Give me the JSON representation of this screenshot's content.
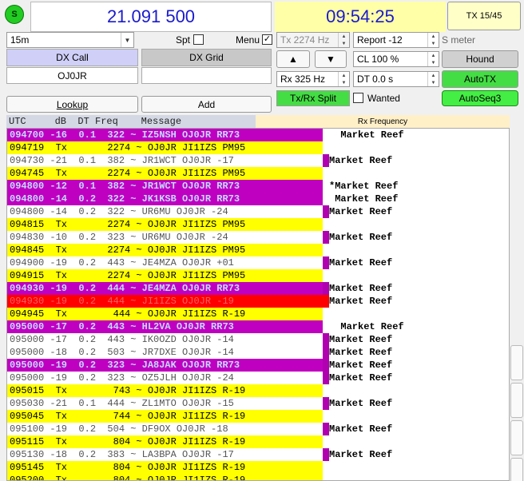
{
  "header": {
    "status_led": "S",
    "frequency": "21.091 500",
    "clock": "09:54:25",
    "tx_button": "TX 15/45"
  },
  "controls": {
    "band": "15m",
    "spt_label": "Spt",
    "menu_label": "Menu",
    "menu_checked": "✓",
    "tx_freq": "Tx  2274  Hz",
    "report": "Report -12",
    "s_meter": "S meter",
    "dx_call_label": "DX Call",
    "dx_grid_label": "DX Grid",
    "dx_call_value": "OJ0JR",
    "dx_grid_value": "",
    "up_arrow": "▲",
    "down_arrow": "▼",
    "cl": "CL  100 %",
    "hound": "Hound",
    "rx_freq": "Rx  325  Hz",
    "dt": "DT 0.0 s",
    "auto_tx": "AutoTX",
    "tx_rx_split": "Tx/Rx Split",
    "wanted_label": "Wanted",
    "auto_seq": "AutoSeq3",
    "lookup": "Lookup",
    "add": "Add"
  },
  "band_header": {
    "columns": "UTC     dB  DT Freq    Message",
    "rx_frequency": "Rx Frequency"
  },
  "decodes": [
    {
      "style": "magenta",
      "text": "094700 -16  0.1  322 ~ IZ5NSH OJ0JR RR73",
      "marker": "",
      "right": "  Market Reef"
    },
    {
      "style": "yellow",
      "text": "094719  Tx       2274 ~ OJ0JR JI1IZS PM95",
      "marker": "",
      "right": ""
    },
    {
      "style": "gray",
      "text": "094730 -21  0.1  382 ~ JR1WCT OJ0JR -17",
      "marker": "magenta",
      "right": "Market Reef"
    },
    {
      "style": "yellow",
      "text": "094745  Tx       2274 ~ OJ0JR JI1IZS PM95",
      "marker": "",
      "right": ""
    },
    {
      "style": "magenta",
      "text": "094800 -12  0.1  382 ~ JR1WCT OJ0JR RR73",
      "marker": "",
      "right": "*Market Reef"
    },
    {
      "style": "magenta",
      "text": "094800 -14  0.2  322 ~ JK1KSB OJ0JR RR73",
      "marker": "",
      "right": " Market Reef"
    },
    {
      "style": "gray",
      "text": "094800 -14  0.2  322 ~ UR6MU OJ0JR -24",
      "marker": "magenta",
      "right": "Market Reef"
    },
    {
      "style": "yellow",
      "text": "094815  Tx       2274 ~ OJ0JR JI1IZS PM95",
      "marker": "",
      "right": ""
    },
    {
      "style": "gray",
      "text": "094830 -10  0.2  323 ~ UR6MU OJ0JR -24",
      "marker": "magenta",
      "right": "Market Reef"
    },
    {
      "style": "yellow",
      "text": "094845  Tx       2274 ~ OJ0JR JI1IZS PM95",
      "marker": "",
      "right": ""
    },
    {
      "style": "gray",
      "text": "094900 -19  0.2  443 ~ JE4MZA OJ0JR +01",
      "marker": "magenta",
      "right": "Market Reef"
    },
    {
      "style": "yellow",
      "text": "094915  Tx       2274 ~ OJ0JR JI1IZS PM95",
      "marker": "",
      "right": ""
    },
    {
      "style": "magenta",
      "text": "094930 -19  0.2  444 ~ JE4MZA OJ0JR RR73",
      "marker": "magenta",
      "right": "Market Reef"
    },
    {
      "style": "red",
      "text": "094930 -19  0.2  444 ~ JI1IZS OJ0JR -19",
      "marker": "red",
      "right": "Market Reef"
    },
    {
      "style": "yellow",
      "text": "094945  Tx        444 ~ OJ0JR JI1IZS R-19",
      "marker": "",
      "right": ""
    },
    {
      "style": "magenta",
      "text": "095000 -17  0.2  443 ~ HL2VA OJ0JR RR73",
      "marker": "",
      "right": "  Market Reef"
    },
    {
      "style": "gray",
      "text": "095000 -17  0.2  443 ~ IK0OZD OJ0JR -14",
      "marker": "magenta",
      "right": "Market Reef"
    },
    {
      "style": "gray",
      "text": "095000 -18  0.2  503 ~ JR7DXE OJ0JR -14",
      "marker": "magenta",
      "right": "Market Reef"
    },
    {
      "style": "magenta",
      "text": "095000 -19  0.2  323 ~ JA8JAK OJ0JR RR73",
      "marker": "magenta",
      "right": "Market Reef"
    },
    {
      "style": "gray",
      "text": "095000 -19  0.2  323 ~ OZ5JLH OJ0JR -24",
      "marker": "magenta",
      "right": "Market Reef"
    },
    {
      "style": "yellow",
      "text": "095015  Tx        743 ~ OJ0JR JI1IZS R-19",
      "marker": "",
      "right": ""
    },
    {
      "style": "gray",
      "text": "095030 -21  0.1  444 ~ ZL1MTO OJ0JR -15",
      "marker": "magenta",
      "right": "Market Reef"
    },
    {
      "style": "yellow",
      "text": "095045  Tx        744 ~ OJ0JR JI1IZS R-19",
      "marker": "",
      "right": ""
    },
    {
      "style": "gray",
      "text": "095100 -19  0.2  504 ~ DF9OX OJ0JR -18",
      "marker": "magenta",
      "right": "Market Reef"
    },
    {
      "style": "yellow",
      "text": "095115  Tx        804 ~ OJ0JR JI1IZS R-19",
      "marker": "",
      "right": ""
    },
    {
      "style": "gray",
      "text": "095130 -18  0.2  383 ~ LA3BPA OJ0JR -17",
      "marker": "magenta",
      "right": "Market Reef"
    },
    {
      "style": "yellow",
      "text": "095145  Tx        804 ~ OJ0JR JI1IZS R-19",
      "marker": "",
      "right": ""
    },
    {
      "style": "yellow",
      "text": "095200  Tx        804 ~ OJ0JR JI1IZS R-19",
      "marker": "",
      "right": ""
    }
  ]
}
